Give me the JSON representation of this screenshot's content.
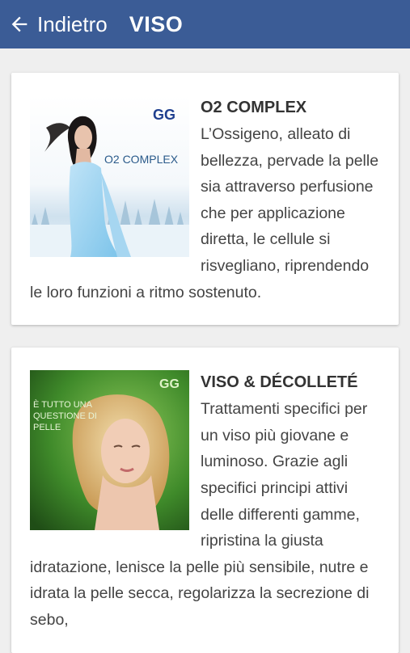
{
  "header": {
    "back_label": "Indietro",
    "title": "VISO",
    "bar_color": "#3b5c96"
  },
  "cards": [
    {
      "title": "O2 COMPLEX",
      "text": "L’Ossigeno, alleato di bellezza, pervade la pelle sia attraverso perfusione che per applicazione diretta, le cellule si risvegliano, riprendendo le loro funzioni a ritmo sostenuto.",
      "image_overlay_text": "O2 COMPLEX",
      "logo": "GG"
    },
    {
      "title": "VISO & DÉCOLLETÉ",
      "text": "Trattamenti specifici per un viso più giovane e luminoso. Grazie agli specifici principi attivi delle differenti gamme, ripristina la giusta idratazione, lenisce la pelle più sensibile, nutre e idrata la pelle secca, regolarizza la secrezione di sebo,",
      "image_overlay_text": "È TUTTO UNA QUESTIONE DI PELLE",
      "logo": "GG"
    }
  ]
}
